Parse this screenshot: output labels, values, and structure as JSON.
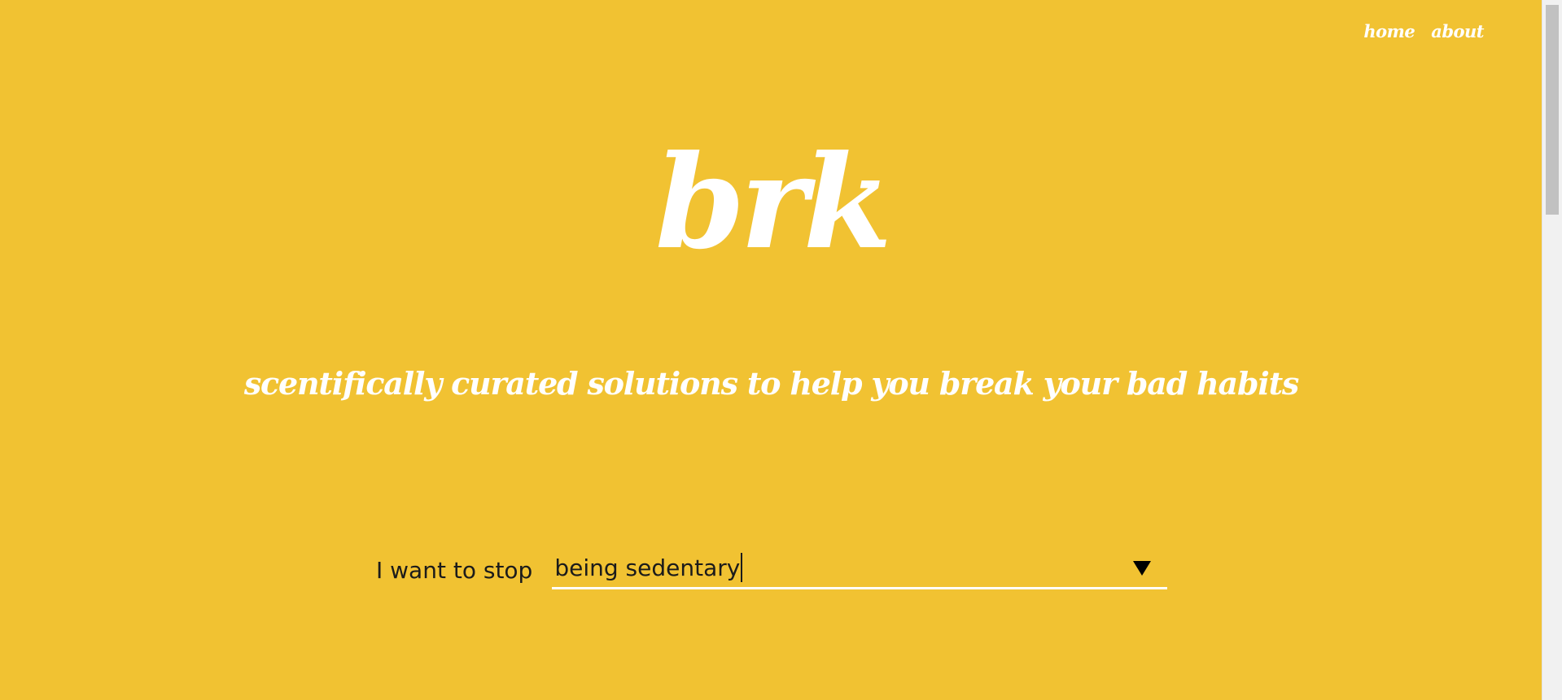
{
  "nav": {
    "home_label": "home",
    "about_label": "about"
  },
  "hero": {
    "logo_text": "brk",
    "tagline": "scentifically curated solutions to help you break your bad habits"
  },
  "habit_form": {
    "label": "I want to stop",
    "input_value": "being sedentary"
  },
  "colors": {
    "background": "#f1c232",
    "text_light": "#ffffff",
    "text_dark": "#1b1b1b"
  }
}
